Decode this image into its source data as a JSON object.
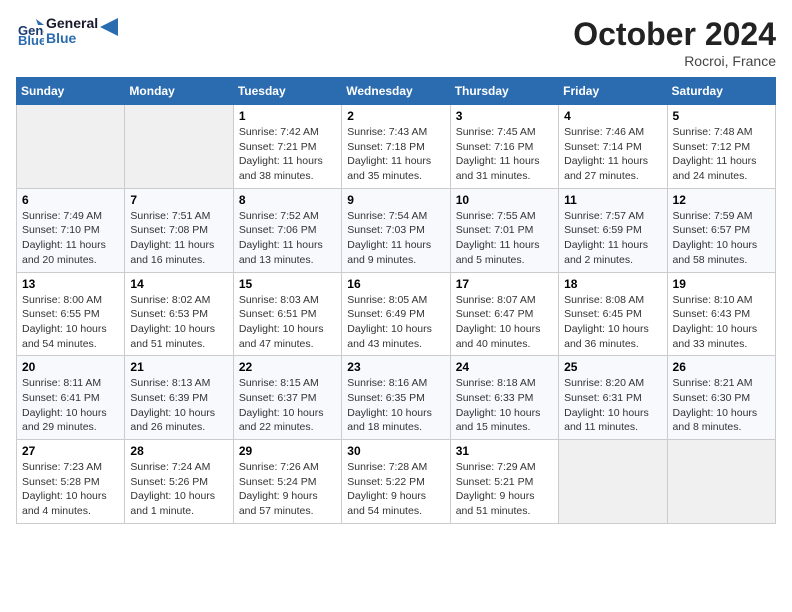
{
  "header": {
    "logo_line1": "General",
    "logo_line2": "Blue",
    "month": "October 2024",
    "location": "Rocroi, France"
  },
  "days_of_week": [
    "Sunday",
    "Monday",
    "Tuesday",
    "Wednesday",
    "Thursday",
    "Friday",
    "Saturday"
  ],
  "weeks": [
    [
      {
        "day": "",
        "info": ""
      },
      {
        "day": "",
        "info": ""
      },
      {
        "day": "1",
        "info": "Sunrise: 7:42 AM\nSunset: 7:21 PM\nDaylight: 11 hours and 38 minutes."
      },
      {
        "day": "2",
        "info": "Sunrise: 7:43 AM\nSunset: 7:18 PM\nDaylight: 11 hours and 35 minutes."
      },
      {
        "day": "3",
        "info": "Sunrise: 7:45 AM\nSunset: 7:16 PM\nDaylight: 11 hours and 31 minutes."
      },
      {
        "day": "4",
        "info": "Sunrise: 7:46 AM\nSunset: 7:14 PM\nDaylight: 11 hours and 27 minutes."
      },
      {
        "day": "5",
        "info": "Sunrise: 7:48 AM\nSunset: 7:12 PM\nDaylight: 11 hours and 24 minutes."
      }
    ],
    [
      {
        "day": "6",
        "info": "Sunrise: 7:49 AM\nSunset: 7:10 PM\nDaylight: 11 hours and 20 minutes."
      },
      {
        "day": "7",
        "info": "Sunrise: 7:51 AM\nSunset: 7:08 PM\nDaylight: 11 hours and 16 minutes."
      },
      {
        "day": "8",
        "info": "Sunrise: 7:52 AM\nSunset: 7:06 PM\nDaylight: 11 hours and 13 minutes."
      },
      {
        "day": "9",
        "info": "Sunrise: 7:54 AM\nSunset: 7:03 PM\nDaylight: 11 hours and 9 minutes."
      },
      {
        "day": "10",
        "info": "Sunrise: 7:55 AM\nSunset: 7:01 PM\nDaylight: 11 hours and 5 minutes."
      },
      {
        "day": "11",
        "info": "Sunrise: 7:57 AM\nSunset: 6:59 PM\nDaylight: 11 hours and 2 minutes."
      },
      {
        "day": "12",
        "info": "Sunrise: 7:59 AM\nSunset: 6:57 PM\nDaylight: 10 hours and 58 minutes."
      }
    ],
    [
      {
        "day": "13",
        "info": "Sunrise: 8:00 AM\nSunset: 6:55 PM\nDaylight: 10 hours and 54 minutes."
      },
      {
        "day": "14",
        "info": "Sunrise: 8:02 AM\nSunset: 6:53 PM\nDaylight: 10 hours and 51 minutes."
      },
      {
        "day": "15",
        "info": "Sunrise: 8:03 AM\nSunset: 6:51 PM\nDaylight: 10 hours and 47 minutes."
      },
      {
        "day": "16",
        "info": "Sunrise: 8:05 AM\nSunset: 6:49 PM\nDaylight: 10 hours and 43 minutes."
      },
      {
        "day": "17",
        "info": "Sunrise: 8:07 AM\nSunset: 6:47 PM\nDaylight: 10 hours and 40 minutes."
      },
      {
        "day": "18",
        "info": "Sunrise: 8:08 AM\nSunset: 6:45 PM\nDaylight: 10 hours and 36 minutes."
      },
      {
        "day": "19",
        "info": "Sunrise: 8:10 AM\nSunset: 6:43 PM\nDaylight: 10 hours and 33 minutes."
      }
    ],
    [
      {
        "day": "20",
        "info": "Sunrise: 8:11 AM\nSunset: 6:41 PM\nDaylight: 10 hours and 29 minutes."
      },
      {
        "day": "21",
        "info": "Sunrise: 8:13 AM\nSunset: 6:39 PM\nDaylight: 10 hours and 26 minutes."
      },
      {
        "day": "22",
        "info": "Sunrise: 8:15 AM\nSunset: 6:37 PM\nDaylight: 10 hours and 22 minutes."
      },
      {
        "day": "23",
        "info": "Sunrise: 8:16 AM\nSunset: 6:35 PM\nDaylight: 10 hours and 18 minutes."
      },
      {
        "day": "24",
        "info": "Sunrise: 8:18 AM\nSunset: 6:33 PM\nDaylight: 10 hours and 15 minutes."
      },
      {
        "day": "25",
        "info": "Sunrise: 8:20 AM\nSunset: 6:31 PM\nDaylight: 10 hours and 11 minutes."
      },
      {
        "day": "26",
        "info": "Sunrise: 8:21 AM\nSunset: 6:30 PM\nDaylight: 10 hours and 8 minutes."
      }
    ],
    [
      {
        "day": "27",
        "info": "Sunrise: 7:23 AM\nSunset: 5:28 PM\nDaylight: 10 hours and 4 minutes."
      },
      {
        "day": "28",
        "info": "Sunrise: 7:24 AM\nSunset: 5:26 PM\nDaylight: 10 hours and 1 minute."
      },
      {
        "day": "29",
        "info": "Sunrise: 7:26 AM\nSunset: 5:24 PM\nDaylight: 9 hours and 57 minutes."
      },
      {
        "day": "30",
        "info": "Sunrise: 7:28 AM\nSunset: 5:22 PM\nDaylight: 9 hours and 54 minutes."
      },
      {
        "day": "31",
        "info": "Sunrise: 7:29 AM\nSunset: 5:21 PM\nDaylight: 9 hours and 51 minutes."
      },
      {
        "day": "",
        "info": ""
      },
      {
        "day": "",
        "info": ""
      }
    ]
  ]
}
